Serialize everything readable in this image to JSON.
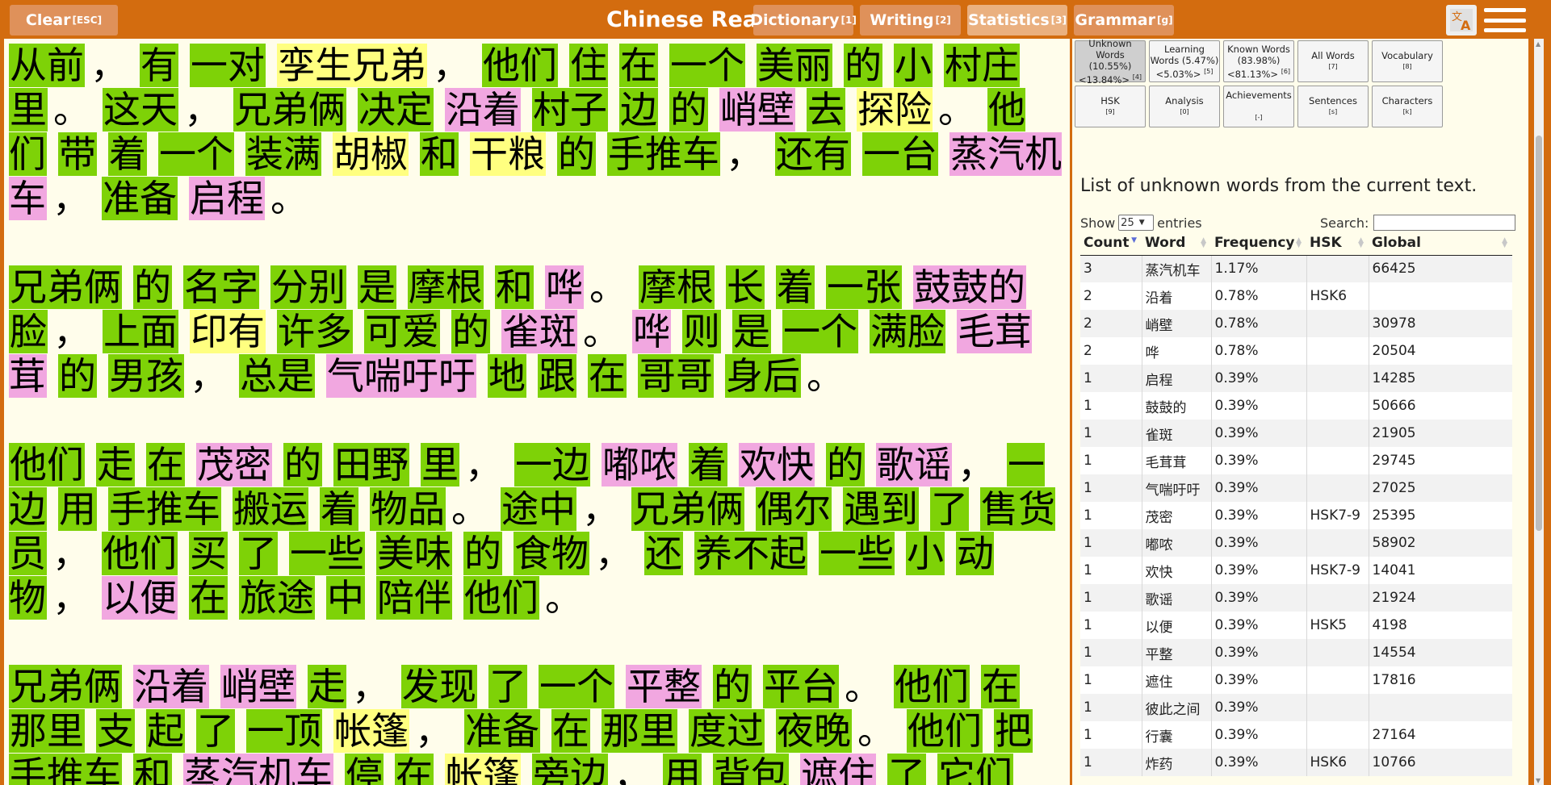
{
  "header": {
    "clear_label": "Clear",
    "clear_key": "[ESC]",
    "title": "Chinese Reader",
    "buttons": [
      {
        "label": "Dictionary",
        "key": "[1]"
      },
      {
        "label": "Writing",
        "key": "[2]"
      },
      {
        "label": "Statistics",
        "key": "[3]"
      },
      {
        "label": "Grammar",
        "key": "[g]"
      }
    ],
    "translate_icon": "translate-icon",
    "menu_icon": "hamburger-menu-icon"
  },
  "colors": {
    "header": "#d36c0f",
    "known": "#7ed207",
    "learning": "#ffff80",
    "unknown": "#f1a7e0",
    "background": "#fffdeb"
  },
  "reader": {
    "paragraphs": [
      [
        [
          "从前",
          "k"
        ],
        [
          "，",
          "p"
        ],
        [
          "有",
          "k"
        ],
        [
          "一对",
          "k"
        ],
        [
          "孪生兄弟",
          "l"
        ],
        [
          "，",
          "p"
        ],
        [
          "他们",
          "k"
        ],
        [
          "住",
          "k"
        ],
        [
          "在",
          "k"
        ],
        [
          "一个",
          "k"
        ],
        [
          "美丽",
          "k"
        ],
        [
          "的",
          "k"
        ],
        [
          "小",
          "k"
        ],
        [
          "村庄",
          "k"
        ],
        [
          "里",
          "k"
        ],
        [
          "。",
          "p"
        ],
        [
          "这天",
          "k"
        ],
        [
          "，",
          "p"
        ],
        [
          "兄弟俩",
          "k"
        ],
        [
          "决定",
          "k"
        ],
        [
          "沿着",
          "u"
        ],
        [
          "村子",
          "k"
        ],
        [
          "边",
          "k"
        ],
        [
          "的",
          "k"
        ],
        [
          "峭壁",
          "u"
        ],
        [
          "去",
          "k"
        ],
        [
          "探险",
          "l"
        ],
        [
          "。",
          "p"
        ],
        [
          "他们",
          "k"
        ],
        [
          "带",
          "k"
        ],
        [
          "着",
          "k"
        ],
        [
          "一个",
          "k"
        ],
        [
          "装满",
          "k"
        ],
        [
          "胡椒",
          "l"
        ],
        [
          "和",
          "k"
        ],
        [
          "干粮",
          "l"
        ],
        [
          "的",
          "k"
        ],
        [
          "手推车",
          "k"
        ],
        [
          "，",
          "p"
        ],
        [
          "还有",
          "k"
        ],
        [
          "一台",
          "k"
        ],
        [
          "蒸汽机车",
          "u"
        ],
        [
          "，",
          "p"
        ],
        [
          "准备",
          "k"
        ],
        [
          "启程",
          "u"
        ],
        [
          "。",
          "p"
        ]
      ],
      [
        [
          "兄弟俩",
          "k"
        ],
        [
          "的",
          "k"
        ],
        [
          "名字",
          "k"
        ],
        [
          "分别",
          "k"
        ],
        [
          "是",
          "k"
        ],
        [
          "摩根",
          "k"
        ],
        [
          "和",
          "k"
        ],
        [
          "哗",
          "u"
        ],
        [
          "。",
          "p"
        ],
        [
          "摩根",
          "k"
        ],
        [
          "长",
          "k"
        ],
        [
          "着",
          "k"
        ],
        [
          "一张",
          "k"
        ],
        [
          "鼓鼓的",
          "u"
        ],
        [
          "脸",
          "k"
        ],
        [
          "，",
          "p"
        ],
        [
          "上面",
          "k"
        ],
        [
          "印有",
          "l"
        ],
        [
          "许多",
          "k"
        ],
        [
          "可爱",
          "k"
        ],
        [
          "的",
          "k"
        ],
        [
          "雀斑",
          "u"
        ],
        [
          "。",
          "p"
        ],
        [
          "哗",
          "u"
        ],
        [
          "则",
          "k"
        ],
        [
          "是",
          "k"
        ],
        [
          "一个",
          "k"
        ],
        [
          "满脸",
          "k"
        ],
        [
          "毛茸茸",
          "u"
        ],
        [
          "的",
          "k"
        ],
        [
          "男孩",
          "k"
        ],
        [
          "，",
          "p"
        ],
        [
          "总是",
          "k"
        ],
        [
          "气喘吁吁",
          "u"
        ],
        [
          "地",
          "k"
        ],
        [
          "跟",
          "k"
        ],
        [
          "在",
          "k"
        ],
        [
          "哥哥",
          "k"
        ],
        [
          "身后",
          "k"
        ],
        [
          "。",
          "p"
        ]
      ],
      [
        [
          "他们",
          "k"
        ],
        [
          "走",
          "k"
        ],
        [
          "在",
          "k"
        ],
        [
          "茂密",
          "u"
        ],
        [
          "的",
          "k"
        ],
        [
          "田野",
          "k"
        ],
        [
          "里",
          "k"
        ],
        [
          "，",
          "p"
        ],
        [
          "一边",
          "k"
        ],
        [
          "嘟哝",
          "u"
        ],
        [
          "着",
          "k"
        ],
        [
          "欢快",
          "u"
        ],
        [
          "的",
          "k"
        ],
        [
          "歌谣",
          "u"
        ],
        [
          "，",
          "p"
        ],
        [
          "一边",
          "k"
        ],
        [
          "用",
          "k"
        ],
        [
          "手推车",
          "k"
        ],
        [
          "搬运",
          "k"
        ],
        [
          "着",
          "k"
        ],
        [
          "物品",
          "k"
        ],
        [
          "。",
          "p"
        ],
        [
          "途中",
          "k"
        ],
        [
          "，",
          "p"
        ],
        [
          "兄弟俩",
          "k"
        ],
        [
          "偶尔",
          "k"
        ],
        [
          "遇到",
          "k"
        ],
        [
          "了",
          "k"
        ],
        [
          "售货员",
          "k"
        ],
        [
          "，",
          "p"
        ],
        [
          "他们",
          "k"
        ],
        [
          "买",
          "k"
        ],
        [
          "了",
          "k"
        ],
        [
          "一些",
          "k"
        ],
        [
          "美味",
          "k"
        ],
        [
          "的",
          "k"
        ],
        [
          "食物",
          "k"
        ],
        [
          "，",
          "p"
        ],
        [
          "还",
          "k"
        ],
        [
          "养不起",
          "k"
        ],
        [
          "一些",
          "k"
        ],
        [
          "小",
          "k"
        ],
        [
          "动物",
          "k"
        ],
        [
          "，",
          "p"
        ],
        [
          "以便",
          "u"
        ],
        [
          "在",
          "k"
        ],
        [
          "旅途",
          "k"
        ],
        [
          "中",
          "k"
        ],
        [
          "陪伴",
          "k"
        ],
        [
          "他们",
          "k"
        ],
        [
          "。",
          "p"
        ]
      ],
      [
        [
          "兄弟俩",
          "k"
        ],
        [
          "沿着",
          "u"
        ],
        [
          "峭壁",
          "u"
        ],
        [
          "走",
          "k"
        ],
        [
          "，",
          "p"
        ],
        [
          "发现",
          "k"
        ],
        [
          "了",
          "k"
        ],
        [
          "一个",
          "k"
        ],
        [
          "平整",
          "u"
        ],
        [
          "的",
          "k"
        ],
        [
          "平台",
          "k"
        ],
        [
          "。",
          "p"
        ],
        [
          "他们",
          "k"
        ],
        [
          "在",
          "k"
        ],
        [
          "那里",
          "k"
        ],
        [
          "支",
          "k"
        ],
        [
          "起",
          "k"
        ],
        [
          "了",
          "k"
        ],
        [
          "一顶",
          "k"
        ],
        [
          "帐篷",
          "l"
        ],
        [
          "，",
          "p"
        ],
        [
          "准备",
          "k"
        ],
        [
          "在",
          "k"
        ],
        [
          "那里",
          "k"
        ],
        [
          "度过",
          "k"
        ],
        [
          "夜晚",
          "k"
        ],
        [
          "。",
          "p"
        ],
        [
          "他们",
          "k"
        ],
        [
          "把",
          "k"
        ],
        [
          "手推车",
          "k"
        ],
        [
          "和",
          "k"
        ],
        [
          "蒸汽机车",
          "u"
        ],
        [
          "停",
          "k"
        ],
        [
          "在",
          "k"
        ],
        [
          "帐篷",
          "l"
        ],
        [
          "旁边",
          "k"
        ],
        [
          "，",
          "p"
        ],
        [
          "用",
          "k"
        ],
        [
          "背包",
          "k"
        ],
        [
          "遮住",
          "u"
        ],
        [
          "了",
          "k"
        ],
        [
          "它们",
          "k"
        ]
      ]
    ]
  },
  "stats_buttons": [
    {
      "label": "Unknown Words (10.55%)",
      "sub": "<13.84%>",
      "key": "[4]",
      "active": true
    },
    {
      "label": "Learning Words (5.47%)",
      "sub": "<5.03%>",
      "key": "[5]"
    },
    {
      "label": "Known Words (83.98%)",
      "sub": "<81.13%>",
      "key": "[6]"
    },
    {
      "label": "All Words",
      "sub": "",
      "key": "[7]"
    },
    {
      "label": "Vocabulary",
      "sub": "",
      "key": "[8]"
    },
    {
      "label": "HSK",
      "sub": "",
      "key": "[9]"
    },
    {
      "label": "Analysis",
      "sub": "",
      "key": "[0]"
    },
    {
      "label": "Achievements",
      "sub": "",
      "key": "[-]"
    },
    {
      "label": "Sentences",
      "sub": "",
      "key": "[s]"
    },
    {
      "label": "Characters",
      "sub": "",
      "key": "[k]"
    }
  ],
  "stats": {
    "subtitle": "List of unknown words from the current text.",
    "show_label": "Show",
    "entries_value": "25",
    "entries_label": "entries",
    "search_label": "Search:",
    "columns": [
      "Count",
      "Word",
      "Frequency",
      "HSK",
      "Global"
    ],
    "rows": [
      [
        "3",
        "蒸汽机车",
        "1.17%",
        "",
        "66425"
      ],
      [
        "2",
        "沿着",
        "0.78%",
        "HSK6",
        ""
      ],
      [
        "2",
        "峭壁",
        "0.78%",
        "",
        "30978"
      ],
      [
        "2",
        "哗",
        "0.78%",
        "",
        "20504"
      ],
      [
        "1",
        "启程",
        "0.39%",
        "",
        "14285"
      ],
      [
        "1",
        "鼓鼓的",
        "0.39%",
        "",
        "50666"
      ],
      [
        "1",
        "雀斑",
        "0.39%",
        "",
        "21905"
      ],
      [
        "1",
        "毛茸茸",
        "0.39%",
        "",
        "29745"
      ],
      [
        "1",
        "气喘吁吁",
        "0.39%",
        "",
        "27025"
      ],
      [
        "1",
        "茂密",
        "0.39%",
        "HSK7-9",
        "25395"
      ],
      [
        "1",
        "嘟哝",
        "0.39%",
        "",
        "58902"
      ],
      [
        "1",
        "欢快",
        "0.39%",
        "HSK7-9",
        "14041"
      ],
      [
        "1",
        "歌谣",
        "0.39%",
        "",
        "21924"
      ],
      [
        "1",
        "以便",
        "0.39%",
        "HSK5",
        "4198"
      ],
      [
        "1",
        "平整",
        "0.39%",
        "",
        "14554"
      ],
      [
        "1",
        "遮住",
        "0.39%",
        "",
        "17816"
      ],
      [
        "1",
        "彼此之间",
        "0.39%",
        "",
        ""
      ],
      [
        "1",
        "行囊",
        "0.39%",
        "",
        "27164"
      ],
      [
        "1",
        "炸药",
        "0.39%",
        "HSK6",
        "10766"
      ]
    ]
  }
}
